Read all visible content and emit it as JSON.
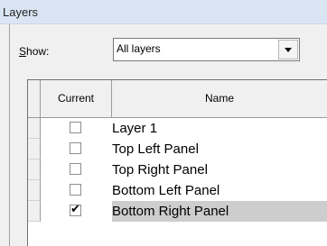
{
  "window": {
    "title": "Layers"
  },
  "show": {
    "label_accel": "S",
    "label_rest": "how:",
    "selected": "All layers"
  },
  "table": {
    "headers": {
      "current": "Current",
      "name": "Name"
    },
    "rows": [
      {
        "current": false,
        "name": "Layer 1"
      },
      {
        "current": false,
        "name": "Top Left Panel"
      },
      {
        "current": false,
        "name": "Top Right Panel"
      },
      {
        "current": false,
        "name": "Bottom Left Panel"
      },
      {
        "current": true,
        "name": "Bottom Right Panel"
      }
    ]
  }
}
